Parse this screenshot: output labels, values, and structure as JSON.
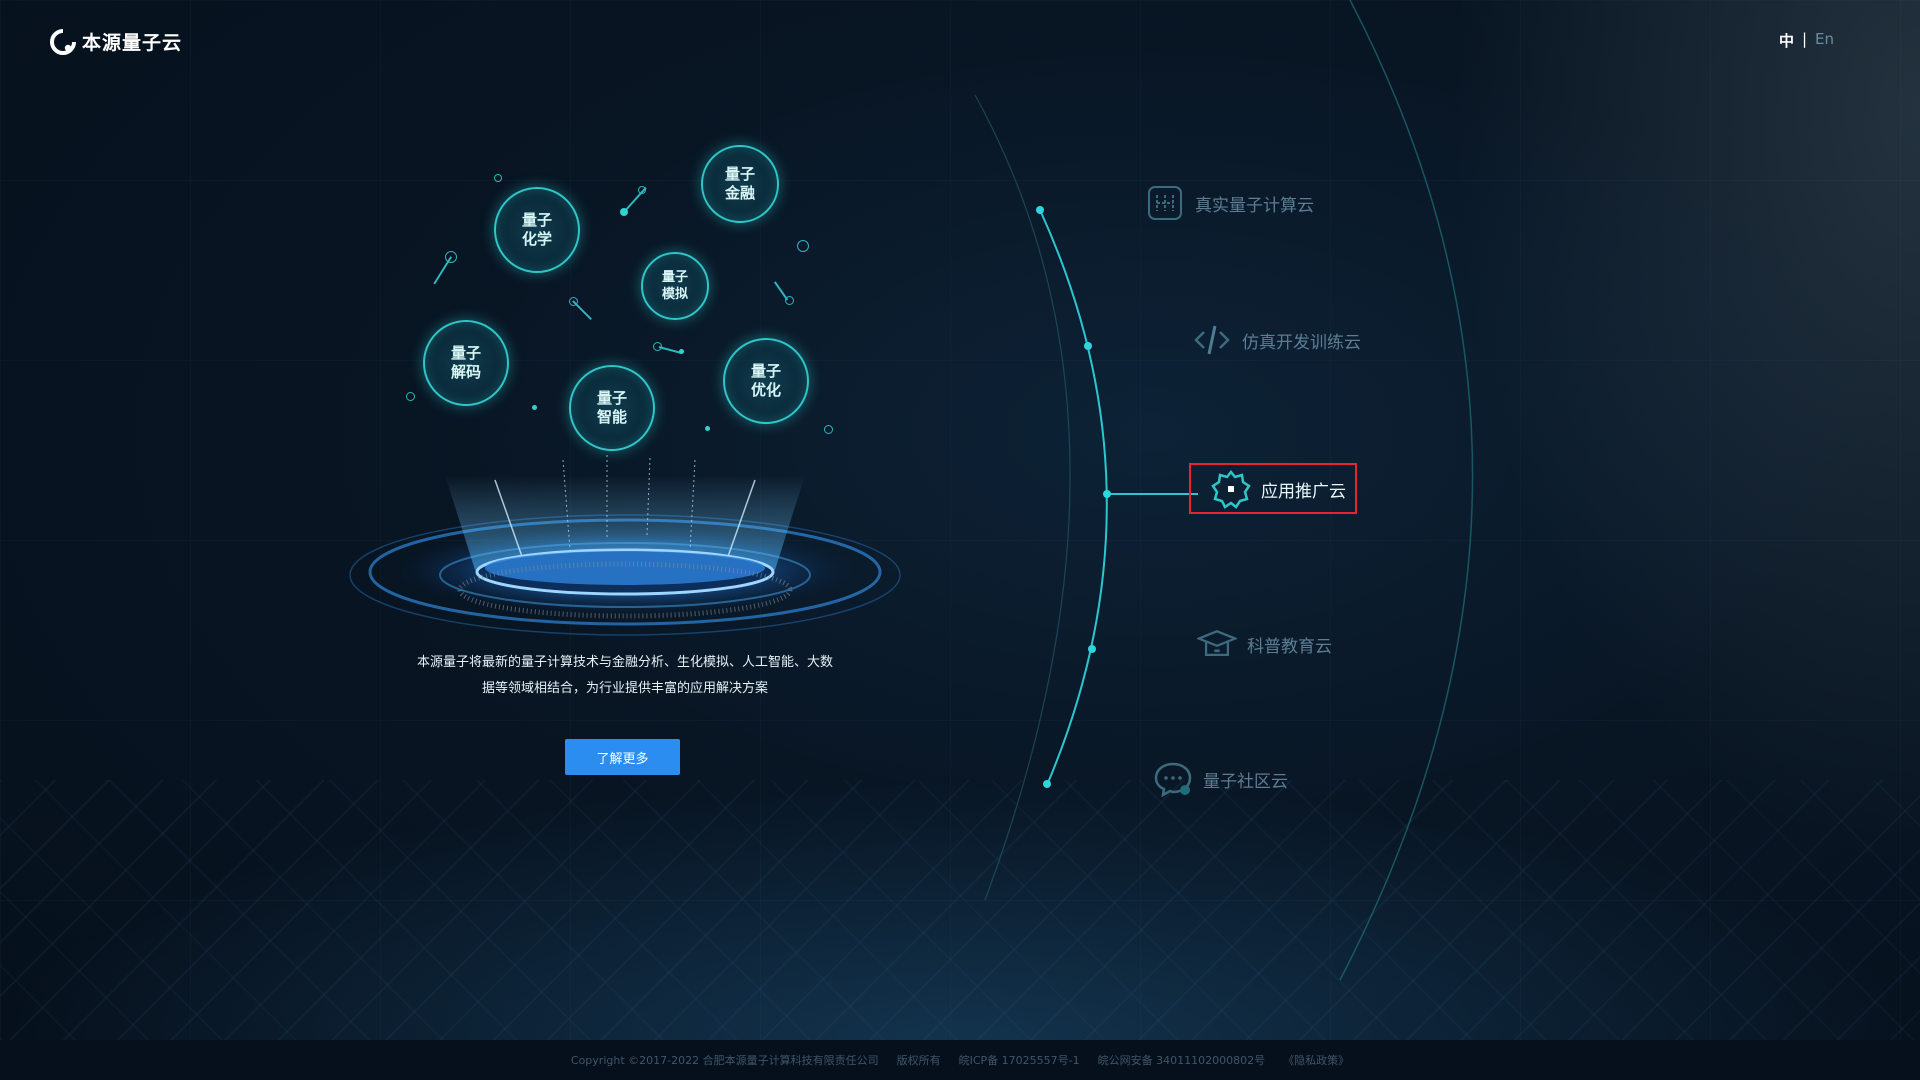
{
  "header": {
    "brand": "本源量子云",
    "lang_zh": "中",
    "lang_sep": "|",
    "lang_en": "En"
  },
  "bubbles": [
    "量子\n金融",
    "量子\n化学",
    "量子\n模拟",
    "量子\n解码",
    "量子\n优化",
    "量子\n智能"
  ],
  "hero": {
    "description_line1": "本源量子将最新的量子计算技术与金融分析、生化模拟、人工智能、大数",
    "description_line2": "据等领域相结合，为行业提供丰富的应用解决方案",
    "more_button": "了解更多"
  },
  "nav": {
    "items": [
      {
        "label": "真实量子计算云",
        "icon": "chip-icon",
        "active": false
      },
      {
        "label": "仿真开发训练云",
        "icon": "code-icon",
        "active": false
      },
      {
        "label": "应用推广云",
        "icon": "gear-icon",
        "active": true
      },
      {
        "label": "科普教育云",
        "icon": "graduation-cap-icon",
        "active": false
      },
      {
        "label": "量子社区云",
        "icon": "chat-icon",
        "active": false
      }
    ]
  },
  "footer": {
    "copyright": "Copyright ©2017-2022 合肥本源量子计算科技有限责任公司",
    "rights": "版权所有",
    "icp": "皖ICP备 17025557号-1",
    "police": "皖公网安备 34011102000802号",
    "privacy": "《隐私政策》"
  },
  "colors": {
    "accent": "#2fc6c8",
    "button": "#2b8df0",
    "highlight": "#e8252e",
    "background": "#081523"
  }
}
